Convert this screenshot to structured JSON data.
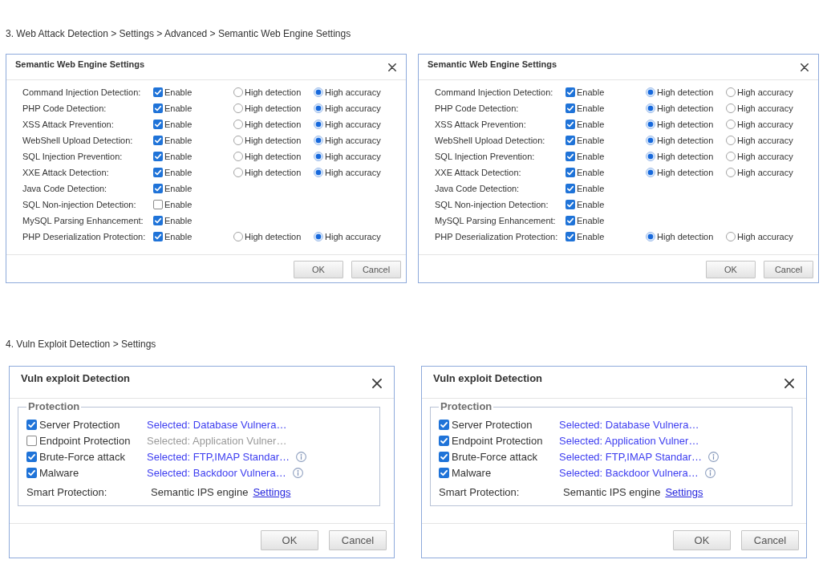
{
  "sections": [
    {
      "kind": "engine",
      "heading": "3. Web Attack Detection > Settings > Advanced > Semantic Web Engine Settings",
      "dialogs": [
        {
          "title": "Semantic Web Engine Settings",
          "rows": [
            {
              "label": "Command Injection Detection:",
              "checked": true,
              "enable": "Enable",
              "modes": [
                {
                  "label": "High detection",
                  "selected": false
                },
                {
                  "label": "High accuracy",
                  "selected": true
                }
              ]
            },
            {
              "label": "PHP Code Detection:",
              "checked": true,
              "enable": "Enable",
              "modes": [
                {
                  "label": "High detection",
                  "selected": false
                },
                {
                  "label": "High accuracy",
                  "selected": true
                }
              ]
            },
            {
              "label": "XSS Attack Prevention:",
              "checked": true,
              "enable": "Enable",
              "modes": [
                {
                  "label": "High detection",
                  "selected": false
                },
                {
                  "label": "High accuracy",
                  "selected": true
                }
              ]
            },
            {
              "label": "WebShell Upload Detection:",
              "checked": true,
              "enable": "Enable",
              "modes": [
                {
                  "label": "High detection",
                  "selected": false
                },
                {
                  "label": "High accuracy",
                  "selected": true
                }
              ]
            },
            {
              "label": "SQL Injection Prevention:",
              "checked": true,
              "enable": "Enable",
              "modes": [
                {
                  "label": "High detection",
                  "selected": false
                },
                {
                  "label": "High accuracy",
                  "selected": true
                }
              ]
            },
            {
              "label": "XXE Attack Detection:",
              "checked": true,
              "enable": "Enable",
              "modes": [
                {
                  "label": "High detection",
                  "selected": false
                },
                {
                  "label": "High accuracy",
                  "selected": true
                }
              ]
            },
            {
              "label": "Java Code Detection:",
              "checked": true,
              "enable": "Enable"
            },
            {
              "label": "SQL Non-injection Detection:",
              "checked": false,
              "enable": "Enable"
            },
            {
              "label": "MySQL Parsing Enhancement:",
              "checked": true,
              "enable": "Enable"
            },
            {
              "label": "PHP Deserialization Protection:",
              "checked": true,
              "enable": "Enable",
              "modes": [
                {
                  "label": "High detection",
                  "selected": false
                },
                {
                  "label": "High accuracy",
                  "selected": true
                }
              ]
            }
          ],
          "buttons": [
            "OK",
            "Cancel"
          ]
        },
        {
          "title": "Semantic Web Engine Settings",
          "rows": [
            {
              "label": "Command Injection Detection:",
              "checked": true,
              "enable": "Enable",
              "modes": [
                {
                  "label": "High detection",
                  "selected": true
                },
                {
                  "label": "High accuracy",
                  "selected": false
                }
              ]
            },
            {
              "label": "PHP Code Detection:",
              "checked": true,
              "enable": "Enable",
              "modes": [
                {
                  "label": "High detection",
                  "selected": true
                },
                {
                  "label": "High accuracy",
                  "selected": false
                }
              ]
            },
            {
              "label": "XSS Attack Prevention:",
              "checked": true,
              "enable": "Enable",
              "modes": [
                {
                  "label": "High detection",
                  "selected": true
                },
                {
                  "label": "High accuracy",
                  "selected": false
                }
              ]
            },
            {
              "label": "WebShell Upload Detection:",
              "checked": true,
              "enable": "Enable",
              "modes": [
                {
                  "label": "High detection",
                  "selected": true
                },
                {
                  "label": "High accuracy",
                  "selected": false
                }
              ]
            },
            {
              "label": "SQL Injection Prevention:",
              "checked": true,
              "enable": "Enable",
              "modes": [
                {
                  "label": "High detection",
                  "selected": true
                },
                {
                  "label": "High accuracy",
                  "selected": false
                }
              ]
            },
            {
              "label": "XXE Attack Detection:",
              "checked": true,
              "enable": "Enable",
              "modes": [
                {
                  "label": "High detection",
                  "selected": true
                },
                {
                  "label": "High accuracy",
                  "selected": false
                }
              ]
            },
            {
              "label": "Java Code Detection:",
              "checked": true,
              "enable": "Enable"
            },
            {
              "label": "SQL Non-injection Detection:",
              "checked": true,
              "enable": "Enable"
            },
            {
              "label": "MySQL Parsing Enhancement:",
              "checked": true,
              "enable": "Enable"
            },
            {
              "label": "PHP Deserialization Protection:",
              "checked": true,
              "enable": "Enable",
              "modes": [
                {
                  "label": "High detection",
                  "selected": true
                },
                {
                  "label": "High accuracy",
                  "selected": false
                }
              ]
            }
          ],
          "buttons": [
            "OK",
            "Cancel"
          ]
        }
      ]
    },
    {
      "kind": "vuln",
      "heading": "4. Vuln Exploit Detection > Settings",
      "dialogs": [
        {
          "title": "Vuln exploit Detection",
          "group": "Protection",
          "rows": [
            {
              "label": "Server Protection",
              "checked": true,
              "link": "Selected: Database Vulnera…",
              "info": false
            },
            {
              "label": "Endpoint Protection",
              "checked": false,
              "link": "Selected: Application Vulner…",
              "info": false
            },
            {
              "label": "Brute-Force attack",
              "checked": true,
              "link": "Selected: FTP,IMAP Standar…",
              "info": true
            },
            {
              "label": "Malware",
              "checked": true,
              "link": "Selected: Backdoor Vulnera…",
              "info": true
            }
          ],
          "smart": {
            "label": "Smart Protection:",
            "value": "Semantic IPS engine",
            "link": "Settings"
          },
          "buttons": [
            "OK",
            "Cancel"
          ]
        },
        {
          "title": "Vuln exploit Detection",
          "group": "Protection",
          "rows": [
            {
              "label": "Server Protection",
              "checked": true,
              "link": "Selected: Database Vulnera…",
              "info": false
            },
            {
              "label": "Endpoint Protection",
              "checked": true,
              "link": "Selected: Application Vulner…",
              "info": false
            },
            {
              "label": "Brute-Force attack",
              "checked": true,
              "link": "Selected: FTP,IMAP Standar…",
              "info": true
            },
            {
              "label": "Malware",
              "checked": true,
              "link": "Selected: Backdoor Vulnera…",
              "info": true
            }
          ],
          "smart": {
            "label": "Smart Protection:",
            "value": "Semantic IPS engine",
            "link": "Settings"
          },
          "buttons": [
            "OK",
            "Cancel"
          ]
        }
      ]
    }
  ]
}
